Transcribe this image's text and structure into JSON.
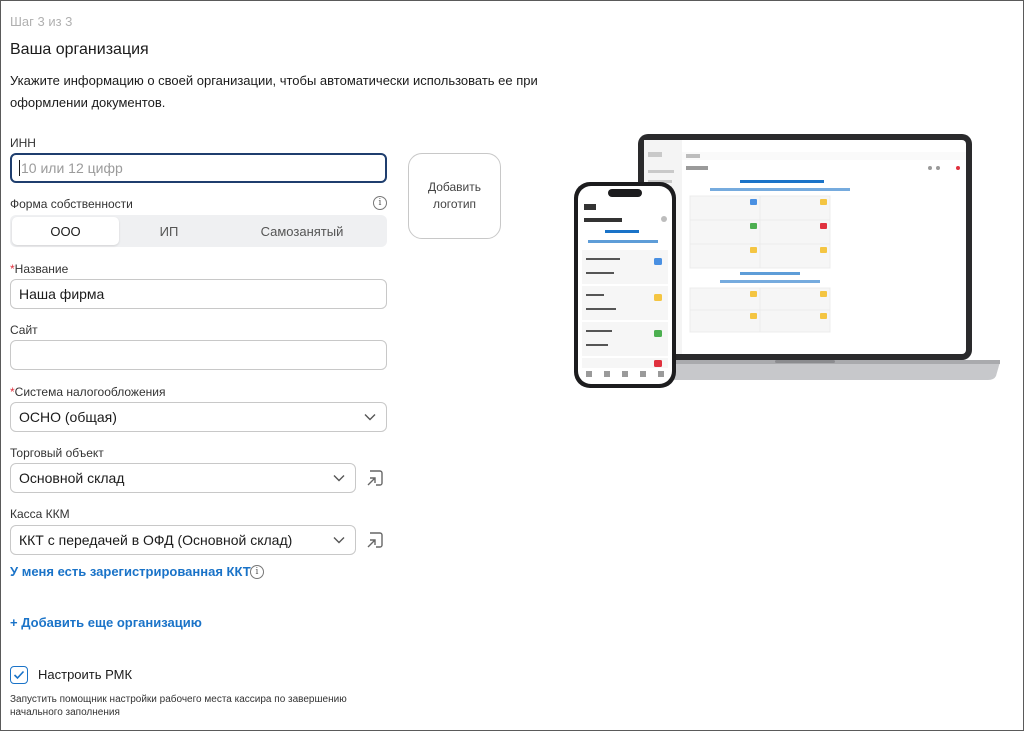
{
  "step": "Шаг 3 из 3",
  "title": "Ваша организация",
  "description": "Укажите информацию о своей организации, чтобы автоматически использовать ее при оформлении документов.",
  "inn": {
    "label": "ИНН",
    "placeholder": "10 или 12 цифр",
    "value": ""
  },
  "logo": {
    "label": "Добавить логотип"
  },
  "ownership": {
    "label": "Форма собственности",
    "options": [
      "ООО",
      "ИП",
      "Самозанятый"
    ],
    "selected": "ООО"
  },
  "name": {
    "required_mark": "*",
    "label": "Название",
    "value": "Наша фирма"
  },
  "site": {
    "label": "Сайт",
    "value": ""
  },
  "tax": {
    "required_mark": "*",
    "label": "Система налогообложения",
    "value": "ОСНО (общая)"
  },
  "store": {
    "label": "Торговый объект",
    "value": "Основной склад"
  },
  "kkm": {
    "label": "Касса ККМ",
    "value": "ККТ с передачей в ОФД (Основной склад)"
  },
  "registered_kkt_link": "У меня есть зарегистрированная ККТ",
  "add_org_link": "+ Добавить еще организацию",
  "rmk": {
    "checked": true,
    "label": "Настроить РМК",
    "hint": "Запустить помощник настройки рабочего места кассира по завершению начального заполнения"
  },
  "colors": {
    "accent": "#1a73c8",
    "focus_border": "#1f3e6e",
    "required": "#e0313e"
  }
}
